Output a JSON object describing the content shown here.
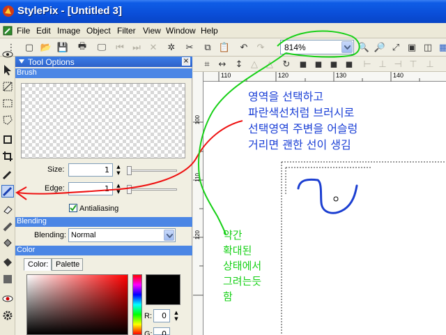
{
  "window": {
    "title": "StylePix - [Untitled 3]"
  },
  "menu": [
    "File",
    "Edit",
    "Image",
    "Object",
    "Filter",
    "View",
    "Window",
    "Help"
  ],
  "toolbar": {
    "zoom": "814%"
  },
  "tool_options": {
    "title": "Tool Options",
    "brush_section": "Brush",
    "size_label": "Size:",
    "size_value": "1",
    "edge_label": "Edge:",
    "edge_value": "1",
    "antialiasing_label": "Antialiasing",
    "blending_section": "Blending",
    "blending_label": "Blending:",
    "blending_value": "Normal",
    "color_section": "Color",
    "color_tab": "Color:",
    "palette_tab": "Palette",
    "r_label": "R:",
    "r_value": "0",
    "g_label": "G:",
    "g_value": "0"
  },
  "rulers": {
    "h": [
      "110",
      "120",
      "130",
      "140"
    ],
    "v": [
      "100",
      "110",
      "120"
    ]
  },
  "annotations": {
    "blue_lines": [
      "영역을 선택하고",
      "파란색선처럼 브러시로",
      "선택영역 주변을 어슬렁",
      "거리면 괜한 선이 생김"
    ],
    "green_lines": [
      "약간",
      "확대된",
      "상태에서",
      "그려는듯",
      "함"
    ]
  },
  "colors": {
    "annotation_blue": "#1a3fd6",
    "annotation_green": "#16d016",
    "annotation_red": "#ee1111"
  }
}
